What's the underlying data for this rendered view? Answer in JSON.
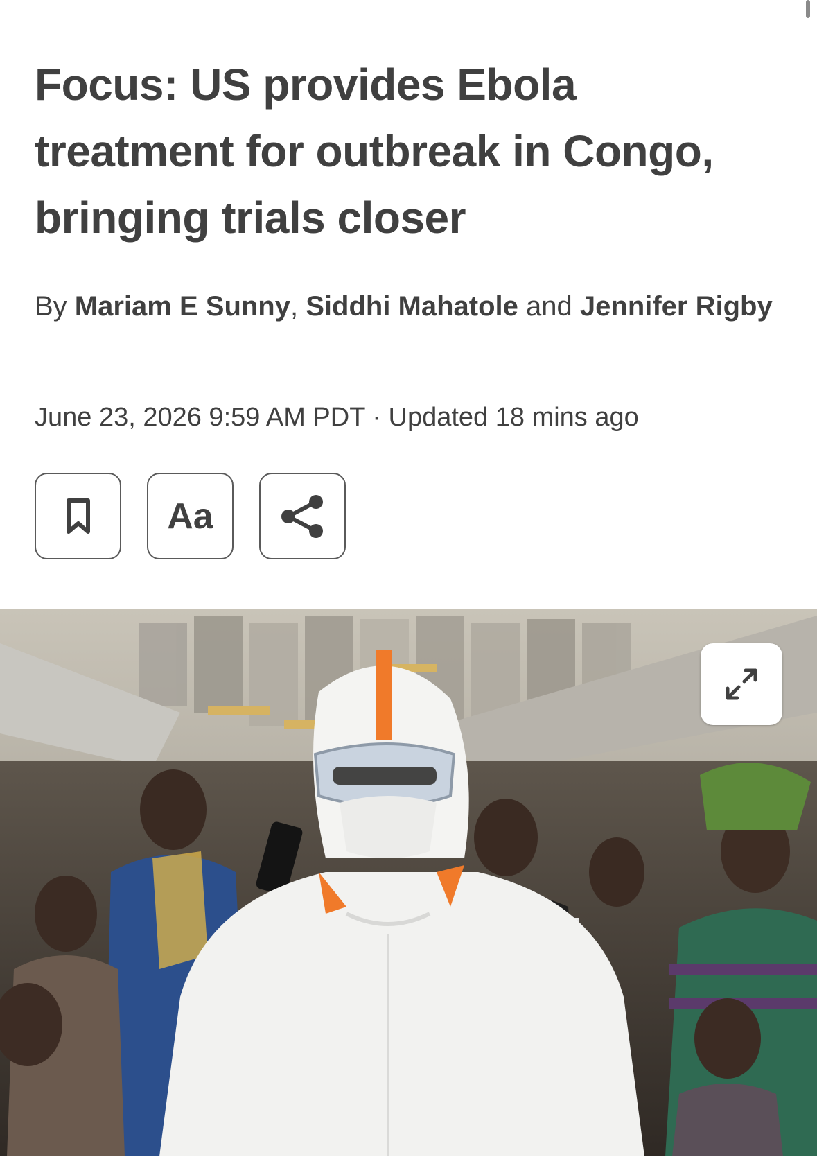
{
  "article": {
    "headline": "Focus: US provides Ebola treatment for outbreak in Congo, bringing trials closer",
    "byline": {
      "prefix": "By ",
      "author1": "Mariam E Sunny",
      "sep1": ", ",
      "author2": "Siddhi Mahatole",
      "conj": " and ",
      "author3": "Jennifer Rigby"
    },
    "timestamp": "June 23, 2026 9:59 AM PDT",
    "separator": " · ",
    "updated": "Updated 18 mins ago"
  },
  "actions": {
    "bookmark_icon": "bookmark-icon",
    "text_size_label": "Aa",
    "share_icon": "share-icon"
  },
  "hero_image": {
    "expand_icon": "expand-icon"
  },
  "colors": {
    "text": "#404040",
    "border": "#5a5a5a",
    "suit": "#f2f2f0",
    "suit_tape": "#f07a2a"
  }
}
